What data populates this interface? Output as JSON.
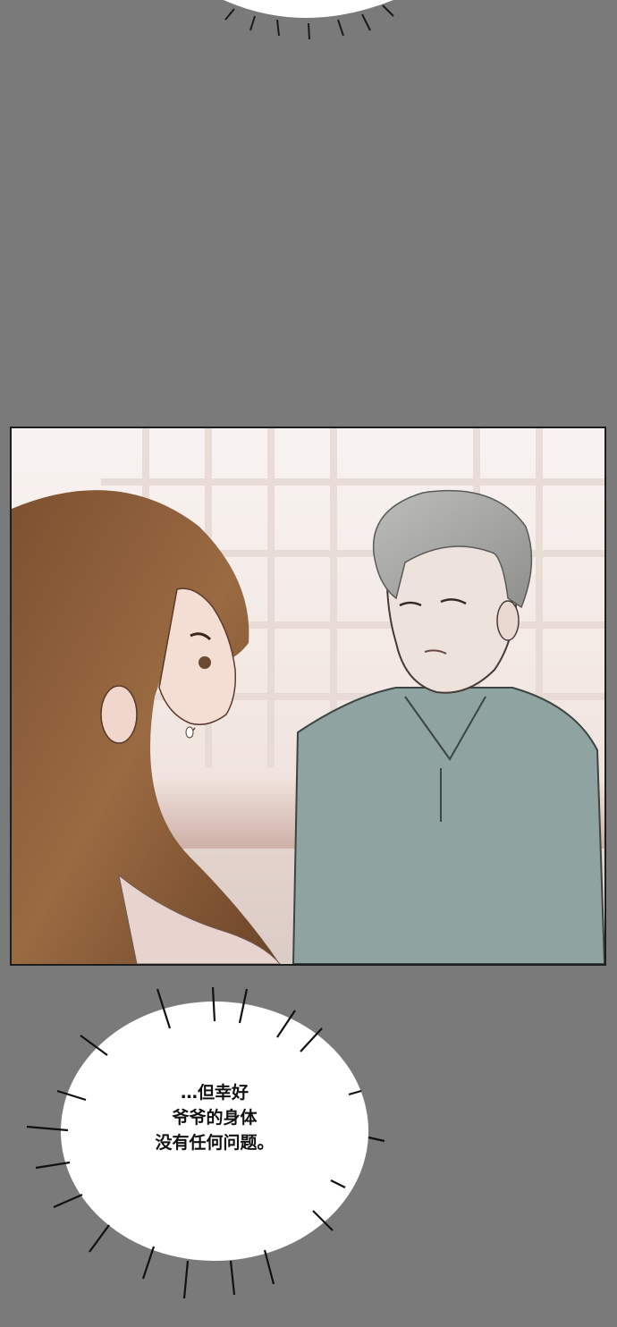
{
  "page": {
    "background": "#7a7a7a"
  },
  "panel": {
    "scene": "woman-and-grandfather",
    "colors": {
      "window_light": "#f6efec",
      "hair_woman": "#8a5a35",
      "hair_grandpa": "#a9a9a7",
      "shirt_grandpa": "#8fa3a1",
      "skin": "#f3ddd3",
      "border": "#1e1e1e"
    }
  },
  "speech": {
    "lines": [
      "…但幸好",
      "爷爷的身体",
      "没有任何问题。"
    ]
  }
}
